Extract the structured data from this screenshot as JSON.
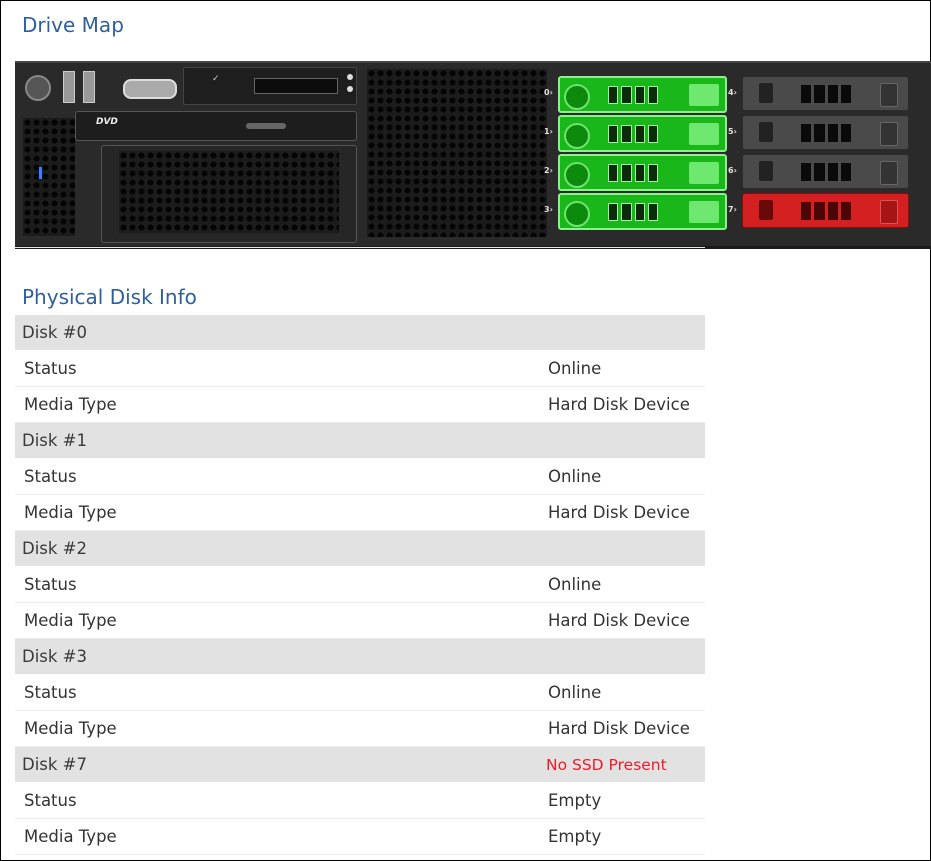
{
  "drive_map": {
    "title": "Drive Map",
    "bays": [
      {
        "slot": "0",
        "state": "online",
        "color": "#19b719"
      },
      {
        "slot": "1",
        "state": "online",
        "color": "#19b719"
      },
      {
        "slot": "2",
        "state": "online",
        "color": "#19b719"
      },
      {
        "slot": "3",
        "state": "online",
        "color": "#19b719"
      },
      {
        "slot": "4",
        "state": "empty",
        "color": "#4a4a4a"
      },
      {
        "slot": "5",
        "state": "empty",
        "color": "#4a4a4a"
      },
      {
        "slot": "6",
        "state": "empty",
        "color": "#4a4a4a"
      },
      {
        "slot": "7",
        "state": "missing",
        "color": "#d42020"
      }
    ],
    "optical_drive_label": "DVD"
  },
  "physical_disk_info": {
    "title": "Physical Disk Info",
    "disks": [
      {
        "name": "Disk #0",
        "header_value": "",
        "status": "Online",
        "media_type": "Hard Disk Device"
      },
      {
        "name": "Disk #1",
        "header_value": "",
        "status": "Online",
        "media_type": "Hard Disk Device"
      },
      {
        "name": "Disk #2",
        "header_value": "",
        "status": "Online",
        "media_type": "Hard Disk Device"
      },
      {
        "name": "Disk #3",
        "header_value": "",
        "status": "Online",
        "media_type": "Hard Disk Device"
      },
      {
        "name": "Disk #7",
        "header_value": "No SSD Present",
        "status": "Empty",
        "media_type": "Empty"
      }
    ],
    "labels": {
      "status": "Status",
      "media_type": "Media Type"
    }
  },
  "colors": {
    "title": "#2f5f9e",
    "alert": "#ee1c2a",
    "header_row": "#e2e2e2"
  }
}
